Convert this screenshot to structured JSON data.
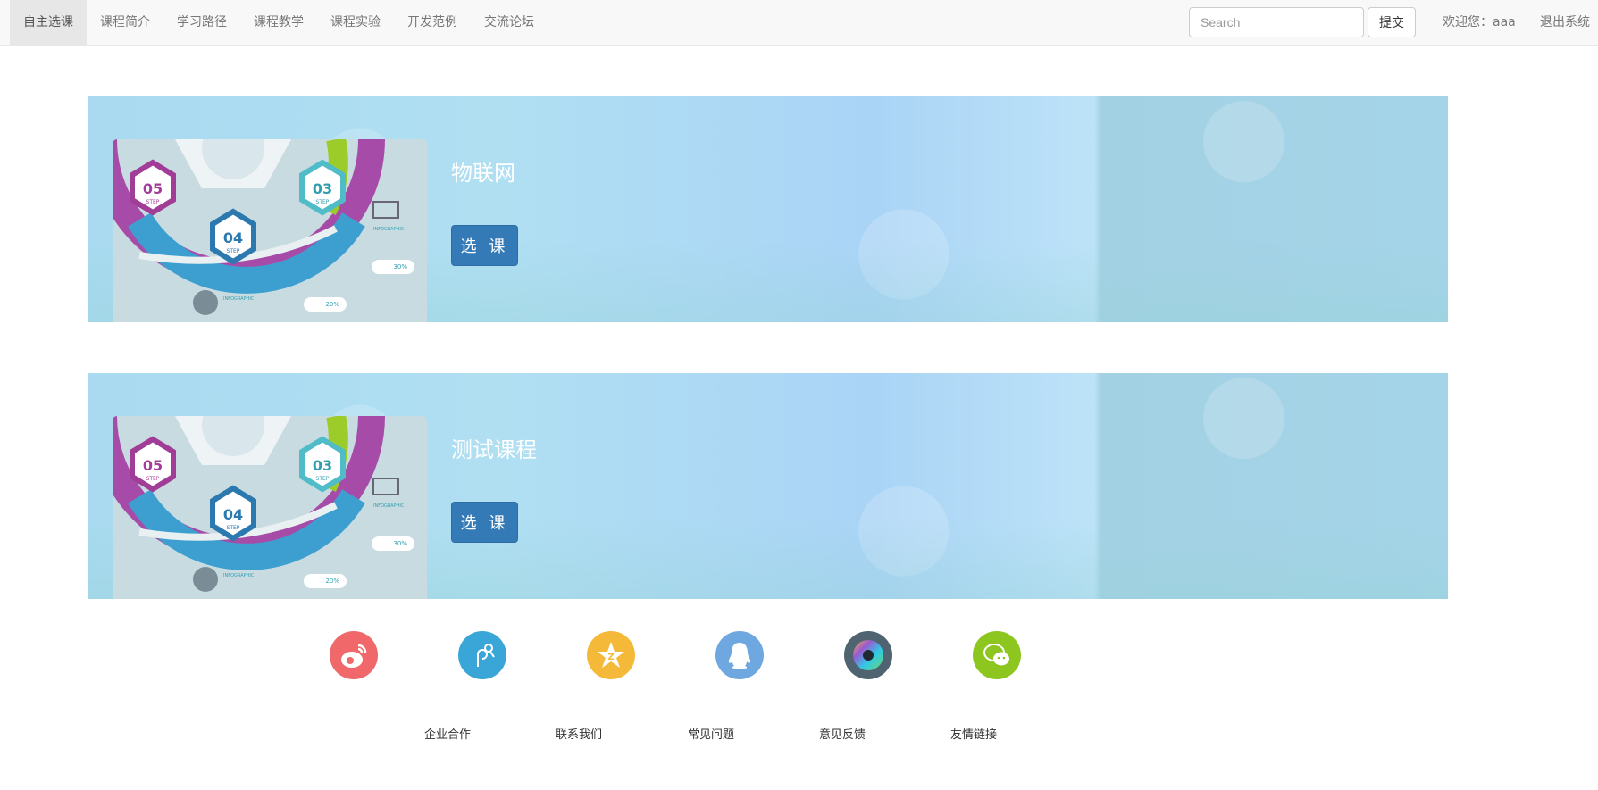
{
  "nav": {
    "items": [
      "自主选课",
      "课程简介",
      "学习路径",
      "课程教学",
      "课程实验",
      "开发范例",
      "交流论坛"
    ],
    "active": 0,
    "search_placeholder": "Search",
    "submit_label": "提交",
    "welcome": "欢迎您：aaa",
    "logout": "退出系统"
  },
  "courses": [
    {
      "title": "物联网",
      "button": "选 课"
    },
    {
      "title": "测试课程",
      "button": "选 课"
    }
  ],
  "course_image_text": {
    "s5": "05",
    "s3": "03",
    "s4": "04",
    "step": "STEP",
    "info": "INFOGRAPHIC",
    "p30": "30%",
    "p20": "20%"
  },
  "social_icons": [
    {
      "name": "weibo-icon",
      "color": "#f0686a"
    },
    {
      "name": "earphone-icon",
      "color": "#3aa6d8"
    },
    {
      "name": "qzone-icon",
      "color": "#f5b93a"
    },
    {
      "name": "qq-icon",
      "color": "#6fa8e0"
    },
    {
      "name": "aperture-icon",
      "color": "#4f6470"
    },
    {
      "name": "wechat-icon",
      "color": "#8cc61e"
    }
  ],
  "footer_links": [
    "企业合作",
    "联系我们",
    "常见问题",
    "意见反馈",
    "友情链接"
  ]
}
